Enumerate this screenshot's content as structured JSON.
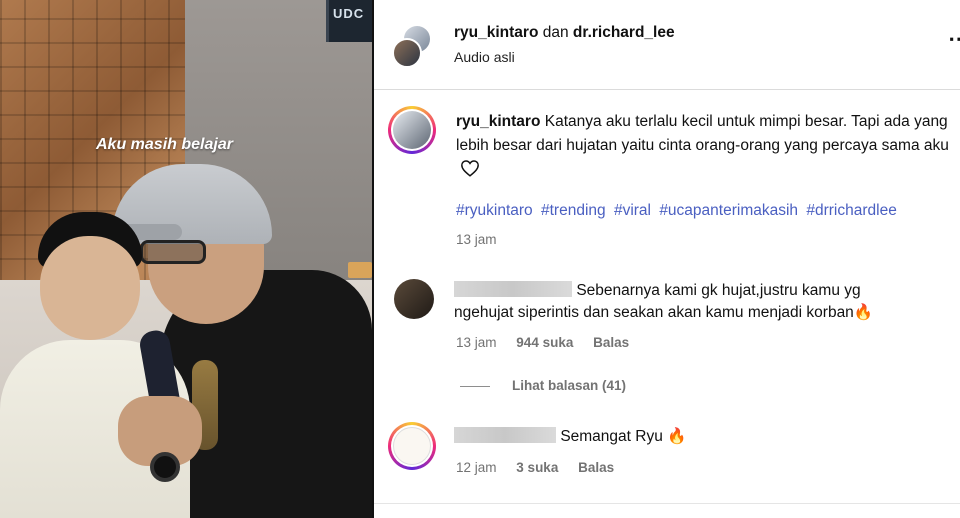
{
  "video": {
    "overlay_text": "Aku masih belajar",
    "tv_text": "UDC"
  },
  "header": {
    "user1": "ryu_kintaro",
    "connector": "dan",
    "user2": "dr.richard_lee",
    "audio": "Audio asli",
    "more_icon": "more-horizontal-icon"
  },
  "caption": {
    "username": "ryu_kintaro",
    "text": "Katanya aku terlalu kecil untuk mimpi besar. Tapi ada yang lebih besar dari hujatan yaitu cinta orang-orang yang percaya sama aku",
    "hashtags": [
      "#ryukintaro",
      "#trending",
      "#viral",
      "#ucapanterimakasih",
      "#drrichardlee"
    ],
    "time": "13 jam"
  },
  "comments": [
    {
      "text": "Sebenarnya kami gk hujat,justru kamu yg ngehujat siperintis dan seakan akan kamu menjadi korban🔥",
      "line1": "Sebenarnya kami gk hujat,justru kamu yg",
      "line2": "ngehujat siperintis dan seakan akan kamu menjadi korban🔥",
      "time": "13 jam",
      "likes": "944 suka",
      "reply": "Balas",
      "view_replies": "Lihat balasan (41)"
    },
    {
      "text": "Semangat Ryu 🔥",
      "time": "12 jam",
      "likes": "3 suka",
      "reply": "Balas"
    }
  ],
  "colors": {
    "hashtag": "#4a5fc1",
    "muted": "#737373"
  }
}
